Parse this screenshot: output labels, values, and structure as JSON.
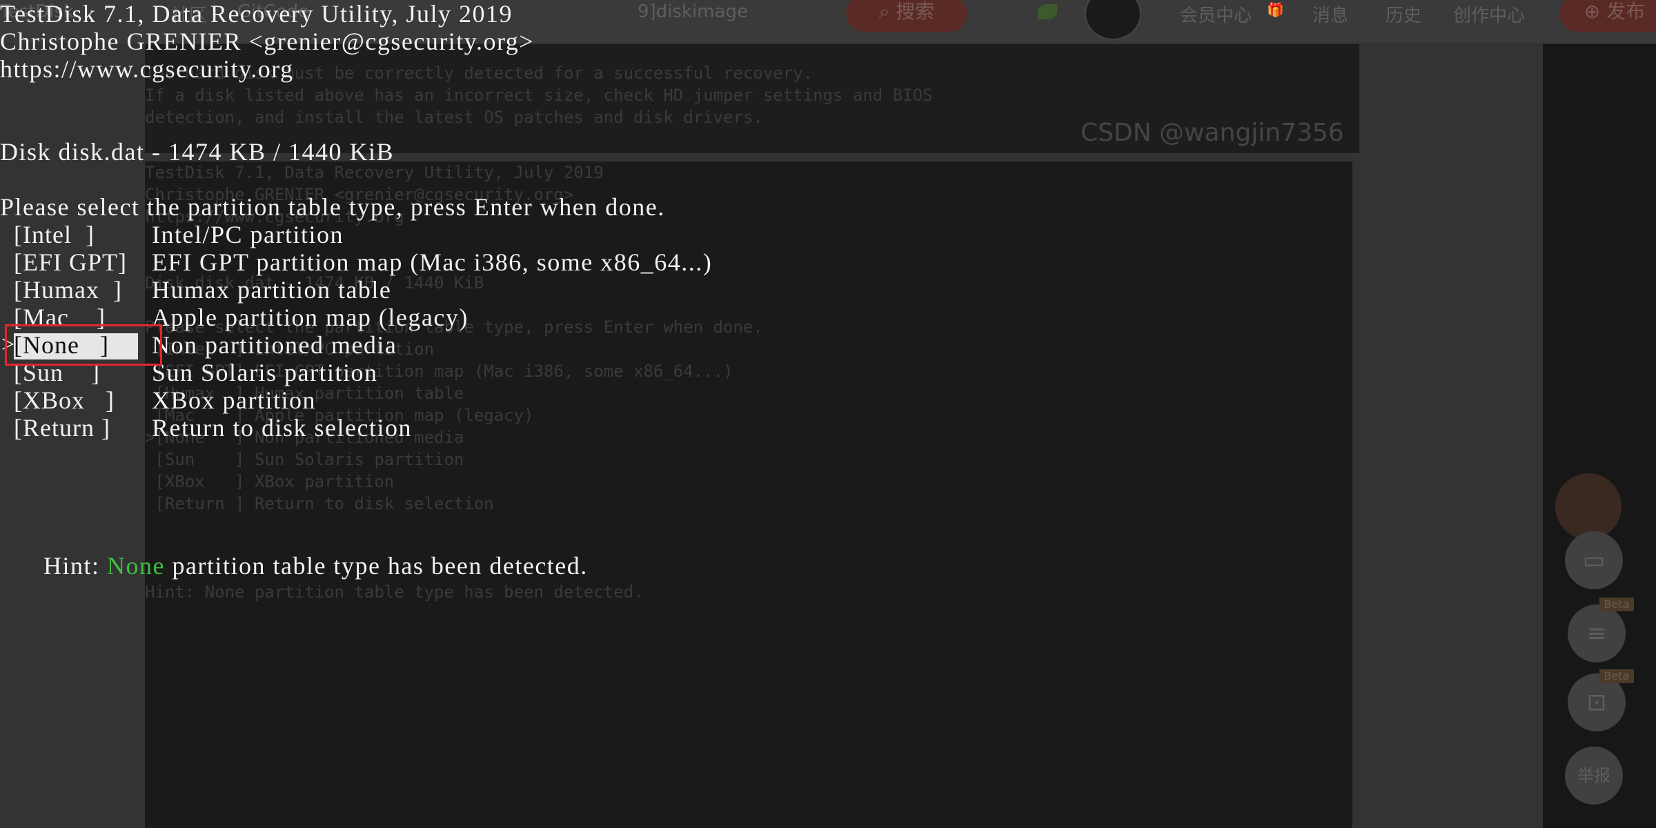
{
  "background_page": {
    "topbar": {
      "fragments": [
        "TestDisk",
        "社区",
        "GitCode",
        "9]diskimage"
      ],
      "search_label": "搜索",
      "nav_items": [
        "会员中心",
        "消息",
        "历史",
        "创作中心"
      ],
      "publish_label": "发布"
    },
    "watermark": "CSDN @wangjin7356",
    "ghost_top_lines": [
      "The hard disk must be correctly detected for a successful recovery.",
      "If a disk listed above has an incorrect size, check HD jumper settings and BIOS",
      "detection, and install the latest OS patches and disk drivers."
    ],
    "ghost_main_lines": [
      "TestDisk 7.1, Data Recovery Utility, July 2019",
      "Christophe GRENIER <grenier@cgsecurity.org>",
      "https://www.cgsecurity.org",
      "",
      "Disk disk.dat - 1474 KB / 1440 KiB",
      "",
      "Please select the partition table type, press Enter when done.",
      " [Intel  ] Intel/PC partition",
      " [EFI GPT] EFI GPT partition map (Mac i386, some x86_64...)",
      " [Humax  ] Humax partition table",
      " [Mac    ] Apple partition map (legacy)",
      ">[None   ] Non partitioned media",
      " [Sun    ] Sun Solaris partition",
      " [XBox   ] XBox partition",
      " [Return ] Return to disk selection",
      "",
      "",
      "",
      "Hint: None partition table type has been detected."
    ],
    "sidebar_buttons": [
      {
        "icon": "chart-icon",
        "label": ""
      },
      {
        "icon": "document-icon",
        "label": ""
      },
      {
        "icon": "crop-icon",
        "label": ""
      },
      {
        "icon": "report-icon",
        "label": "举报"
      }
    ],
    "beta_label": "Beta"
  },
  "terminal": {
    "header_lines": [
      "TestDisk 7.1, Data Recovery Utility, July 2019",
      "Christophe GRENIER <grenier@cgsecurity.org>",
      "https://www.cgsecurity.org"
    ],
    "disk_line": "Disk disk.dat - 1474 KB / 1440 KiB",
    "prompt": "Please select the partition table type, press Enter when done.",
    "menu": [
      {
        "key": "[Intel  ]",
        "desc": "Intel/PC partition",
        "selected": false
      },
      {
        "key": "[EFI GPT]",
        "desc": "EFI GPT partition map (Mac i386, some x86_64...)",
        "selected": false
      },
      {
        "key": "[Humax  ]",
        "desc": "Humax partition table",
        "selected": false
      },
      {
        "key": "[Mac    ]",
        "desc": "Apple partition map (legacy)",
        "selected": false
      },
      {
        "key": "[None   ]",
        "desc": "Non partitioned media",
        "selected": true
      },
      {
        "key": "[Sun    ]",
        "desc": "Sun Solaris partition",
        "selected": false
      },
      {
        "key": "[XBox   ]",
        "desc": "XBox partition",
        "selected": false
      },
      {
        "key": "[Return ]",
        "desc": "Return to disk selection",
        "selected": false
      }
    ],
    "selection_marker": ">",
    "hint": {
      "prefix": "Hint: ",
      "value": "None",
      "suffix": " partition table type has been detected."
    },
    "colors": {
      "text": "#f2f2f2",
      "hint_value": "#3fbf3f",
      "annotation": "#e8242c",
      "selection_bg": "#e6e6e6"
    }
  }
}
